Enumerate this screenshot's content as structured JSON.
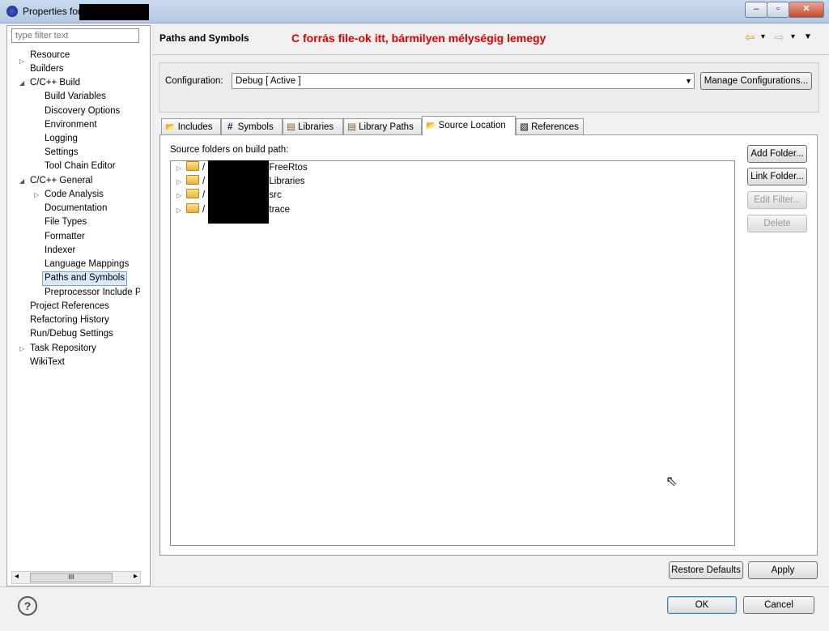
{
  "window": {
    "title": "Properties for",
    "controls": {
      "minimize": "‒",
      "maximize": "▫",
      "close": "✕"
    }
  },
  "filter": {
    "placeholder": "type filter text"
  },
  "tree": [
    {
      "label": "Resource",
      "expander": "▷"
    },
    {
      "label": "Builders",
      "expander": ""
    },
    {
      "label": "C/C++ Build",
      "expander": "◢"
    },
    {
      "label": "Build Variables",
      "expander": ""
    },
    {
      "label": "Discovery Options",
      "expander": ""
    },
    {
      "label": "Environment",
      "expander": ""
    },
    {
      "label": "Logging",
      "expander": ""
    },
    {
      "label": "Settings",
      "expander": ""
    },
    {
      "label": "Tool Chain Editor",
      "expander": ""
    },
    {
      "label": "C/C++ General",
      "expander": "◢"
    },
    {
      "label": "Code Analysis",
      "expander": "▷"
    },
    {
      "label": "Documentation",
      "expander": ""
    },
    {
      "label": "File Types",
      "expander": ""
    },
    {
      "label": "Formatter",
      "expander": ""
    },
    {
      "label": "Indexer",
      "expander": ""
    },
    {
      "label": "Language Mappings",
      "expander": ""
    },
    {
      "label": "Paths and Symbols",
      "expander": ""
    },
    {
      "label": "Preprocessor Include Pa",
      "expander": ""
    },
    {
      "label": "Project References",
      "expander": ""
    },
    {
      "label": "Refactoring History",
      "expander": ""
    },
    {
      "label": "Run/Debug Settings",
      "expander": ""
    },
    {
      "label": "Task Repository",
      "expander": "▷"
    },
    {
      "label": "WikiText",
      "expander": ""
    }
  ],
  "scrollbar": {
    "left": "◂",
    "grip": "III",
    "right": "▸"
  },
  "header": {
    "title": "Paths and Symbols",
    "annotation": "C forrás file-ok itt, bármilyen mélységig lemegy",
    "nav": {
      "back": "⇦",
      "back_menu": "▾",
      "forward": "⇨",
      "forward_menu": "▾",
      "view_menu": "▼"
    }
  },
  "configuration": {
    "label": "Configuration:",
    "value": "Debug  [ Active ]",
    "dropdown_glyph": "▼",
    "manage_label": "Manage Configurations..."
  },
  "tabs": [
    {
      "label": "Includes",
      "icon": "📂"
    },
    {
      "label": "Symbols",
      "icon": "#"
    },
    {
      "label": "Libraries",
      "icon": "▤"
    },
    {
      "label": "Library Paths",
      "icon": "▤"
    },
    {
      "label": "Source Location",
      "icon": "📂"
    },
    {
      "label": "References",
      "icon": "▧"
    }
  ],
  "source": {
    "heading": "Source folders on build path:",
    "folders": [
      {
        "prefix": "/",
        "suffix": "/FreeRtos"
      },
      {
        "prefix": "/",
        "suffix": "/Libraries"
      },
      {
        "prefix": "/",
        "suffix": "/src"
      },
      {
        "prefix": "/",
        "suffix": "/trace"
      }
    ],
    "expander_glyph": "▷",
    "buttons": {
      "add_folder": "Add Folder...",
      "link_folder": "Link Folder...",
      "edit_filter": "Edit Filter...",
      "delete": "Delete"
    }
  },
  "footer": {
    "restore_defaults": "Restore Defaults",
    "apply": "Apply",
    "ok": "OK",
    "cancel": "Cancel",
    "help_glyph": "?"
  },
  "cursor_glyph": "⇖",
  "colors": {
    "annotation": "#e00000",
    "selection": "#dbe8f8",
    "redaction": "#000000"
  }
}
